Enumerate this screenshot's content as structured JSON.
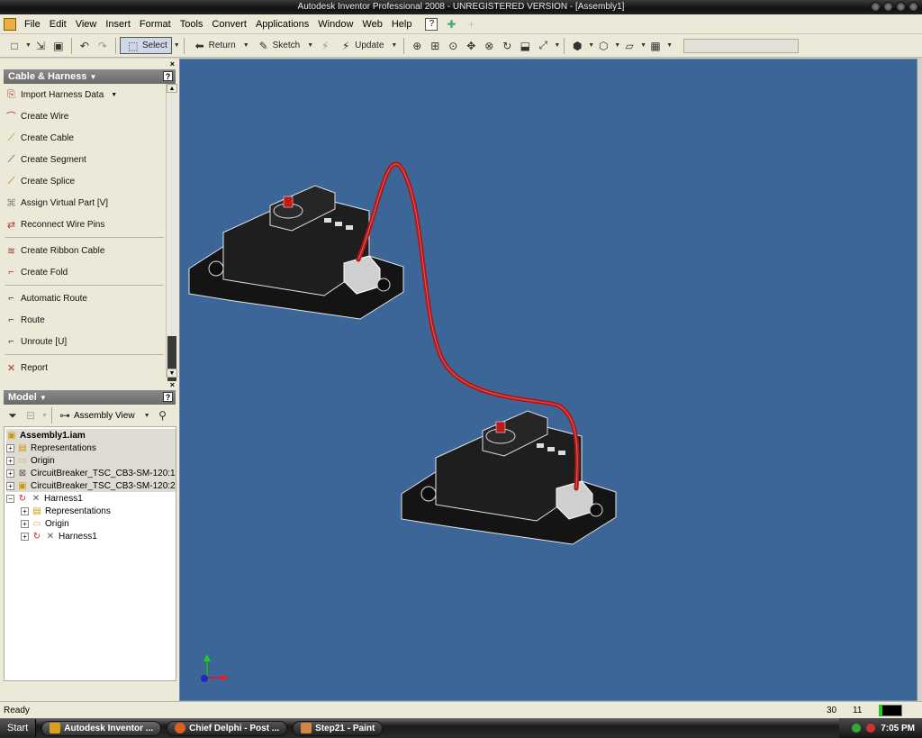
{
  "window": {
    "title": "Autodesk Inventor Professional 2008 - UNREGISTERED VERSION - [Assembly1]"
  },
  "menu": [
    "File",
    "Edit",
    "View",
    "Insert",
    "Format",
    "Tools",
    "Convert",
    "Applications",
    "Window",
    "Web",
    "Help"
  ],
  "toolbar": {
    "select_label": "Select",
    "return_label": "Return",
    "sketch_label": "Sketch",
    "update_label": "Update"
  },
  "harness_panel": {
    "title": "Cable & Harness",
    "items": [
      {
        "label": "Import Harness Data",
        "icon": "import-icon"
      },
      {
        "label": "Create Wire",
        "icon": "wire-icon"
      },
      {
        "label": "Create Cable",
        "icon": "cable-icon"
      },
      {
        "label": "Create Segment",
        "icon": "segment-icon"
      },
      {
        "label": "Create Splice",
        "icon": "splice-icon"
      },
      {
        "label": "Assign Virtual Part   [V]",
        "icon": "virtual-part-icon"
      },
      {
        "label": "Reconnect Wire Pins",
        "icon": "reconnect-icon"
      },
      {
        "label": "Create Ribbon Cable",
        "icon": "ribbon-cable-icon"
      },
      {
        "label": "Create Fold",
        "icon": "fold-icon"
      },
      {
        "label": "Automatic Route",
        "icon": "auto-route-icon"
      },
      {
        "label": "Route",
        "icon": "route-icon"
      },
      {
        "label": "Unroute   [U]",
        "icon": "unroute-icon"
      },
      {
        "label": "Report",
        "icon": "report-icon"
      }
    ]
  },
  "model_panel": {
    "title": "Model",
    "view_label": "Assembly View",
    "tree": [
      {
        "label": "Assembly1.iam",
        "bold": true
      },
      {
        "label": "Representations"
      },
      {
        "label": "Origin"
      },
      {
        "label": "CircuitBreaker_TSC_CB3-SM-120:1"
      },
      {
        "label": "CircuitBreaker_TSC_CB3-SM-120:2"
      },
      {
        "label": "Harness1"
      },
      {
        "label": "Representations"
      },
      {
        "label": "Origin"
      },
      {
        "label": "Harness1"
      }
    ]
  },
  "status": {
    "text": "Ready",
    "num1": "30",
    "num2": "11"
  },
  "taskbar": {
    "start": "Start",
    "tasks": [
      "Autodesk Inventor ...",
      "Chief Delphi - Post ...",
      "Step21 - Paint"
    ],
    "clock": "7:05 PM"
  },
  "colors": {
    "viewport_bg": "#3c6698",
    "wire": "#b01818",
    "part": "#1a1a1a"
  }
}
